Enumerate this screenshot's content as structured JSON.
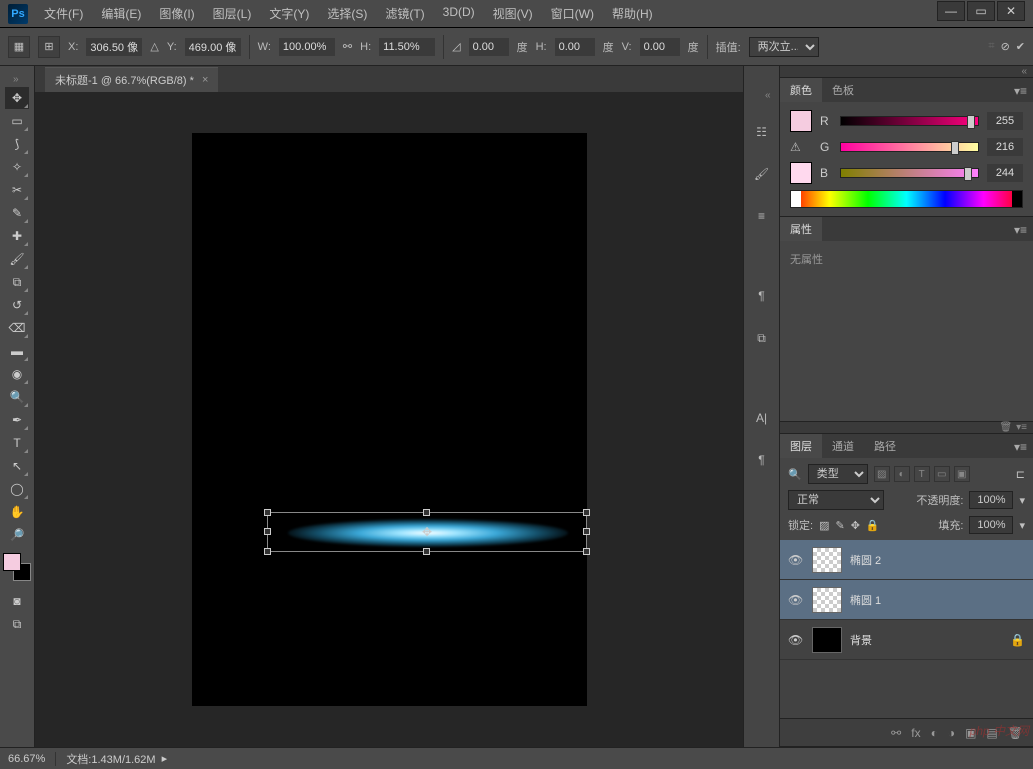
{
  "app": {
    "logo": "Ps"
  },
  "menu": {
    "items": [
      "文件(F)",
      "编辑(E)",
      "图像(I)",
      "图层(L)",
      "文字(Y)",
      "选择(S)",
      "滤镜(T)",
      "3D(D)",
      "视图(V)",
      "窗口(W)",
      "帮助(H)"
    ]
  },
  "window_controls": {
    "min": "—",
    "max": "▭",
    "close": "✕"
  },
  "options": {
    "x_label": "X:",
    "x": "306.50 像",
    "y_label": "Y:",
    "y": "469.00 像",
    "w_label": "W:",
    "w": "100.00%",
    "h_label": "H:",
    "h": "11.50%",
    "angle": "0.00",
    "angle_unit": "度",
    "hskew_label": "H:",
    "hskew": "0.00",
    "hskew_unit": "度",
    "vskew_label": "V:",
    "vskew": "0.00",
    "vskew_unit": "度",
    "interp_label": "插值:",
    "interp": "两次立..."
  },
  "doc": {
    "tab": "未标题-1 @ 66.7%(RGB/8) *",
    "close": "×"
  },
  "status": {
    "zoom": "66.67%",
    "doc_info": "文档:1.43M/1.62M"
  },
  "panels": {
    "color_tab": "颜色",
    "swatches_tab": "色板",
    "r_label": "R",
    "g_label": "G",
    "b_label": "B",
    "r_val": "255",
    "g_val": "216",
    "b_val": "244",
    "props_tab": "属性",
    "props_text": "无属性",
    "layers_tab": "图层",
    "channels_tab": "通道",
    "paths_tab": "路径",
    "type_filter": "类型",
    "blend": "正常",
    "opacity_label": "不透明度:",
    "opacity": "100%",
    "lock_label": "锁定:",
    "fill_label": "填充:",
    "fill": "100%",
    "layer1": "椭圆 2",
    "layer2": "椭圆 1",
    "layer3": "背景"
  },
  "watermark": "php 中文网"
}
